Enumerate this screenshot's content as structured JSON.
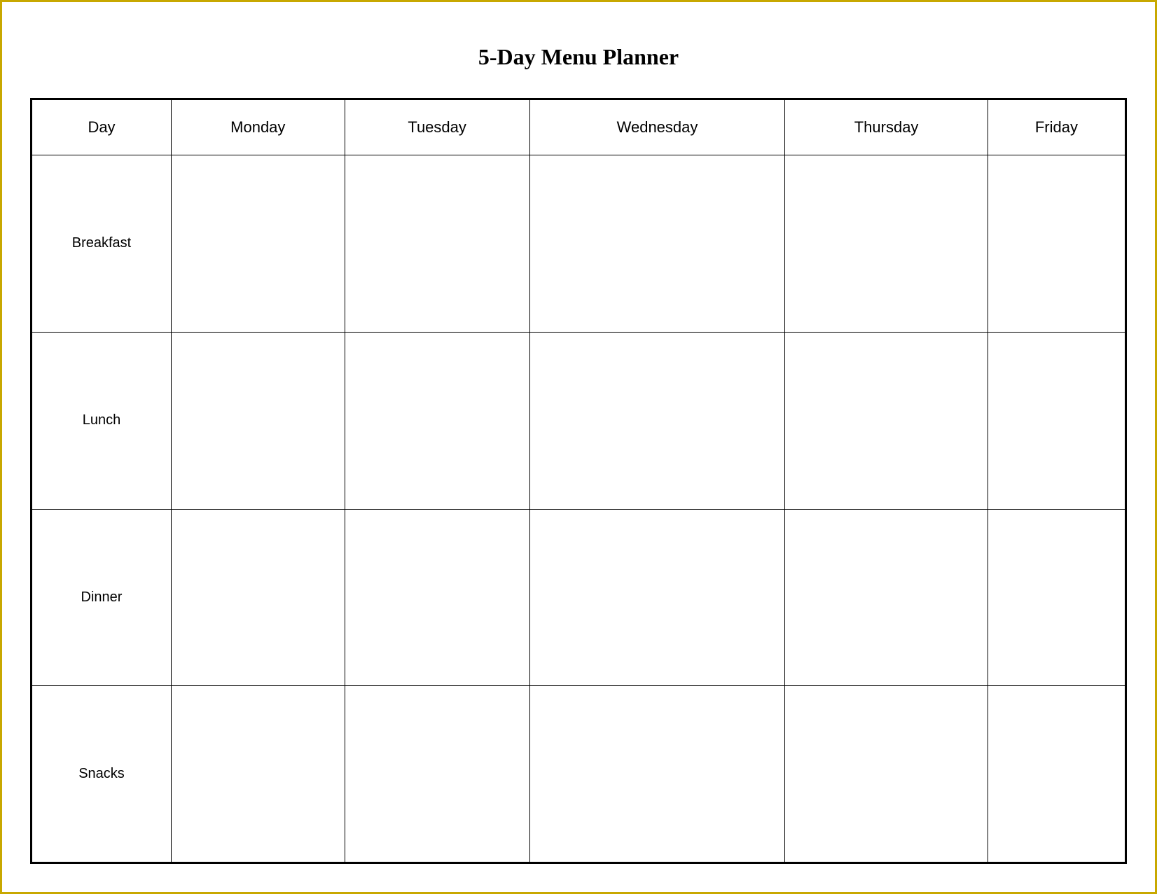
{
  "title": "5-Day Menu Planner",
  "columns": {
    "day": "Day",
    "monday": "Monday",
    "tuesday": "Tuesday",
    "wednesday": "Wednesday",
    "thursday": "Thursday",
    "friday": "Friday"
  },
  "rows": [
    {
      "label": "Breakfast"
    },
    {
      "label": "Lunch"
    },
    {
      "label": "Dinner"
    },
    {
      "label": "Snacks"
    }
  ]
}
